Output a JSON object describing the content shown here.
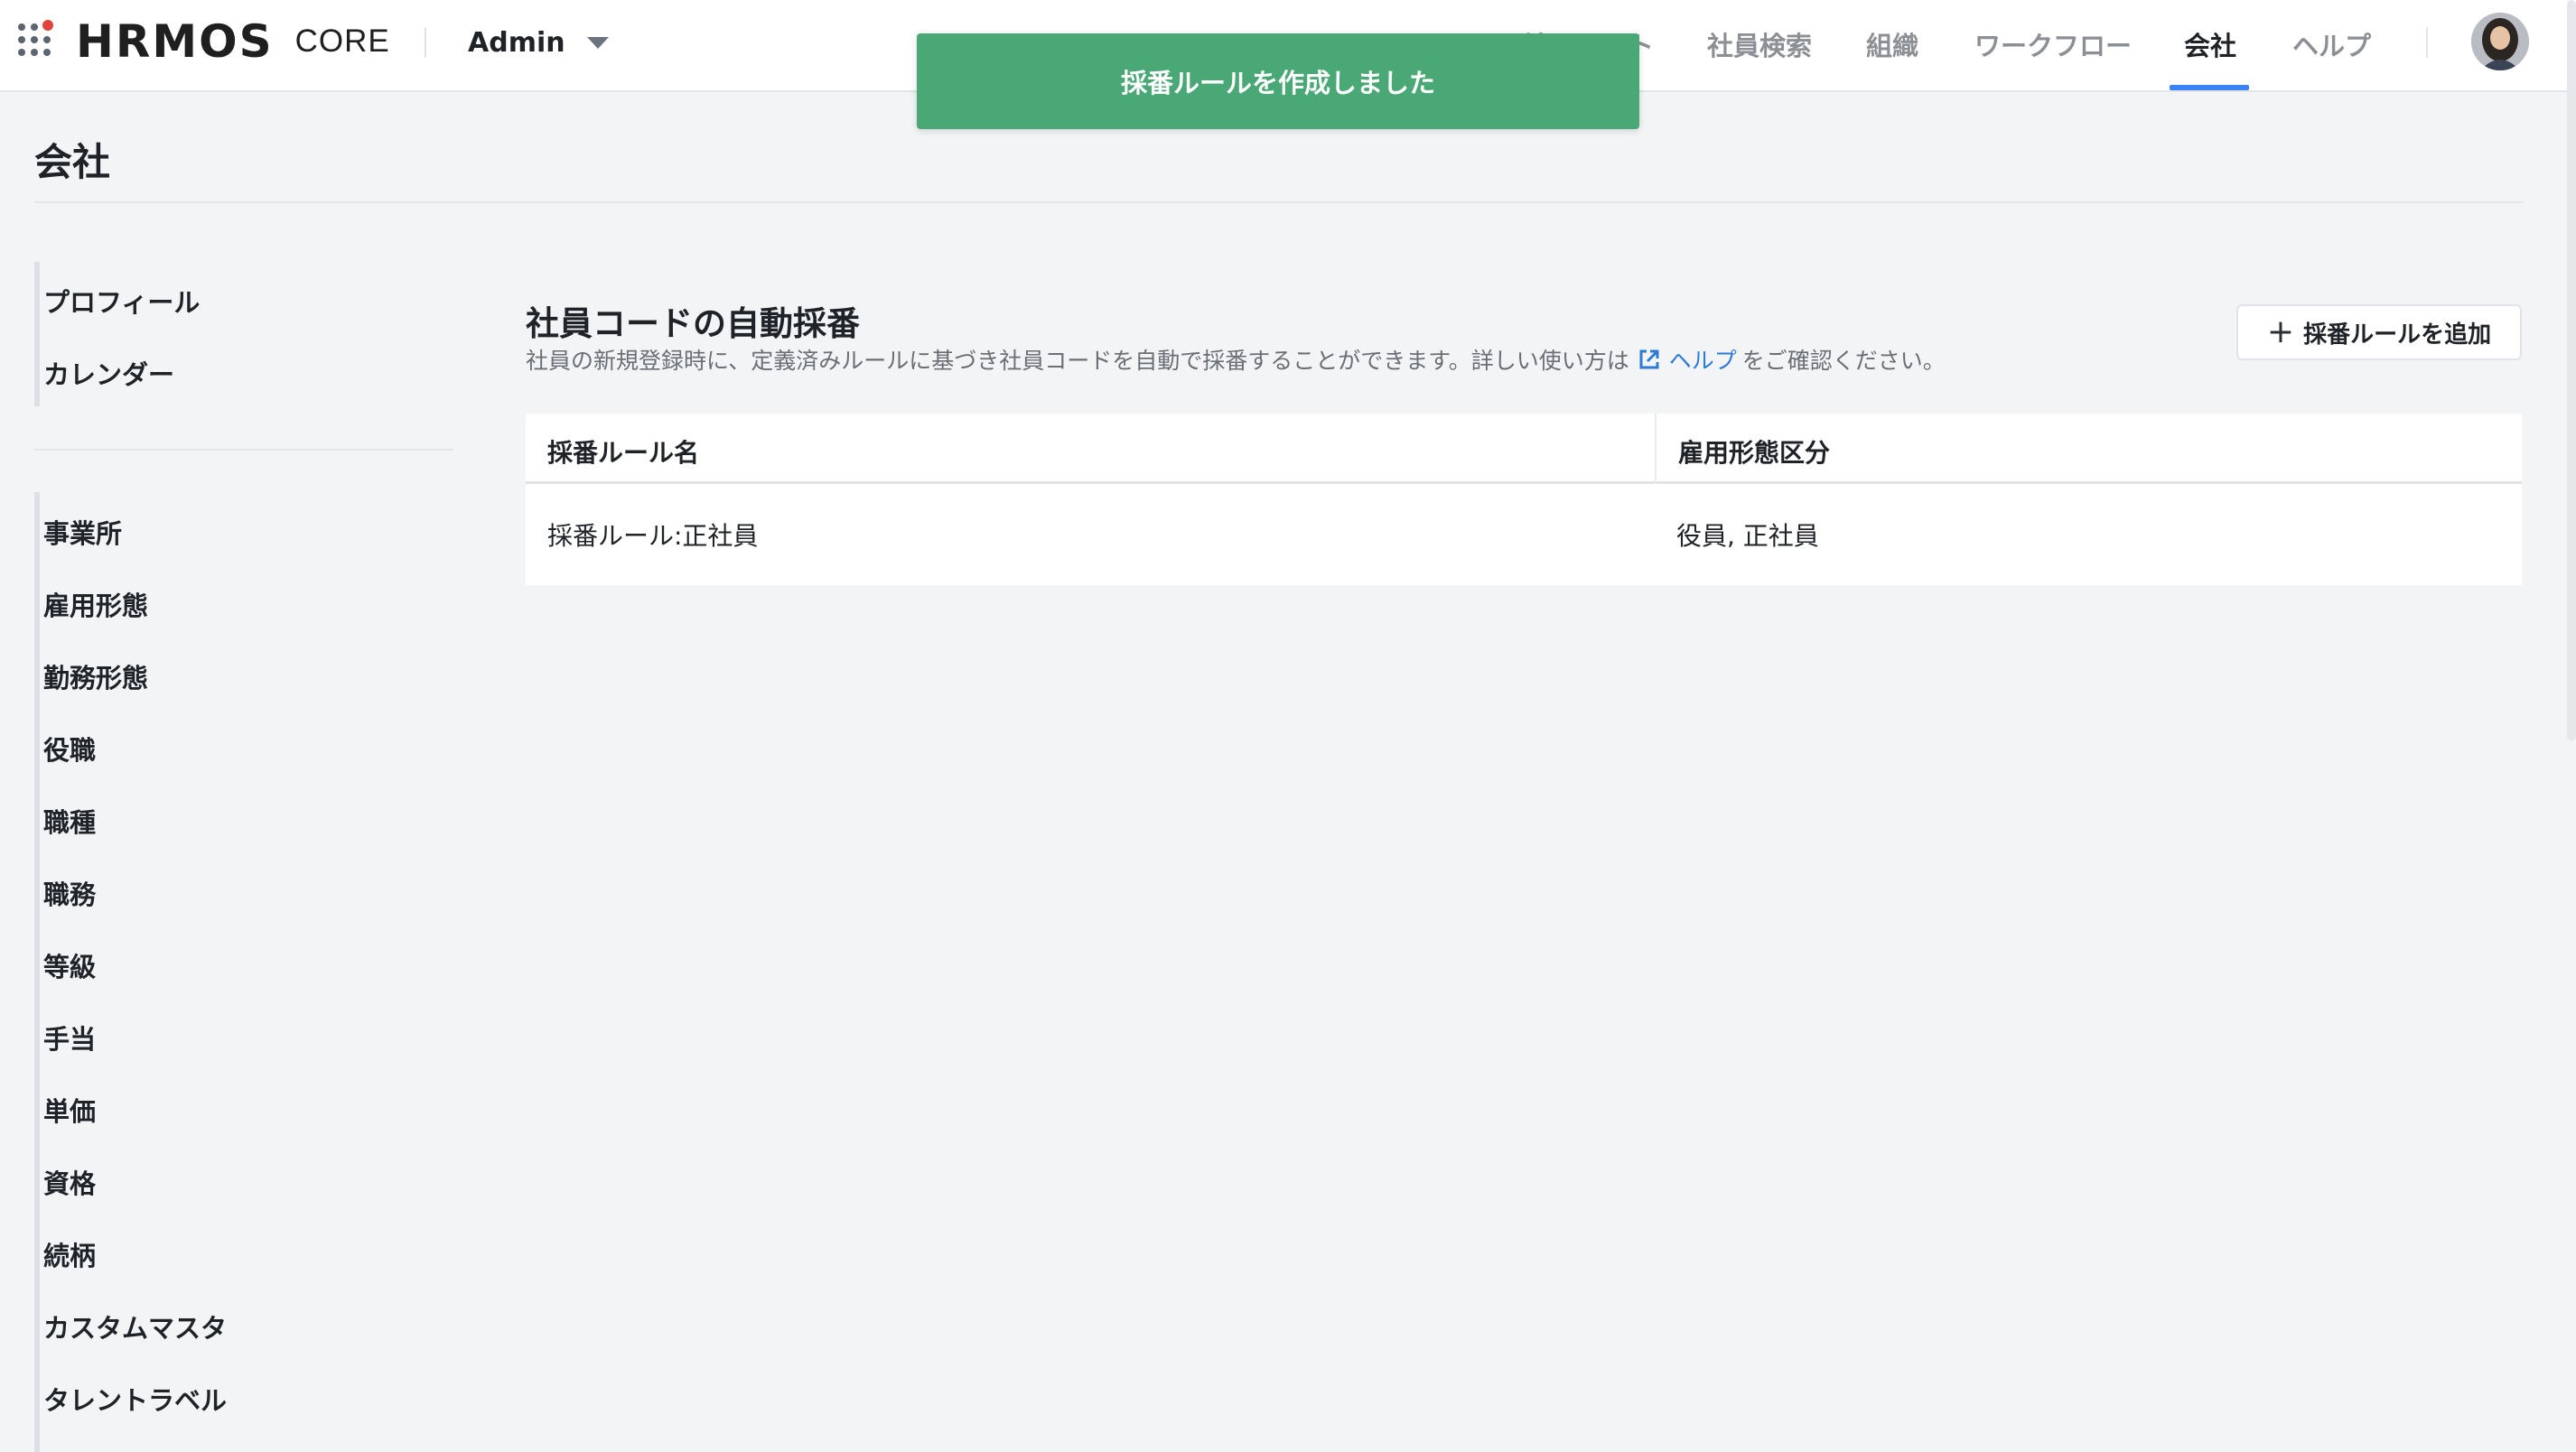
{
  "header": {
    "logo": "HRMOS",
    "product": "CORE",
    "admin_label": "Admin",
    "nav": [
      {
        "label": "社員リスト",
        "active": false
      },
      {
        "label": "社員検索",
        "active": false
      },
      {
        "label": "組織",
        "active": false
      },
      {
        "label": "ワークフロー",
        "active": false
      },
      {
        "label": "会社",
        "active": true
      },
      {
        "label": "ヘルプ",
        "active": false
      }
    ]
  },
  "toast": {
    "message": "採番ルールを作成しました",
    "color": "#4aa876"
  },
  "page": {
    "title": "会社"
  },
  "sidebar": {
    "group1": [
      {
        "label": "プロフィール"
      },
      {
        "label": "カレンダー"
      }
    ],
    "group2": [
      {
        "label": "事業所"
      },
      {
        "label": "雇用形態"
      },
      {
        "label": "勤務形態"
      },
      {
        "label": "役職"
      },
      {
        "label": "職種"
      },
      {
        "label": "職務"
      },
      {
        "label": "等級"
      },
      {
        "label": "手当"
      },
      {
        "label": "単価"
      },
      {
        "label": "資格"
      },
      {
        "label": "続柄"
      },
      {
        "label": "カスタムマスタ"
      },
      {
        "label": "タレントラベル"
      }
    ]
  },
  "section": {
    "title": "社員コードの自動採番",
    "desc_before": "社員の新規登録時に、定義済みルールに基づき社員コードを自動で採番することができます。詳しい使い方は",
    "help_link": "ヘルプ",
    "desc_after": "をご確認ください。",
    "add_button": "採番ルールを追加"
  },
  "table": {
    "headers": [
      "採番ルール名",
      "雇用形態区分"
    ],
    "rows": [
      [
        "採番ルール:正社員",
        "役員, 正社員"
      ]
    ]
  },
  "colors": {
    "accent": "#3b82f6",
    "link": "#2e7bd6",
    "toast": "#4aa876"
  }
}
